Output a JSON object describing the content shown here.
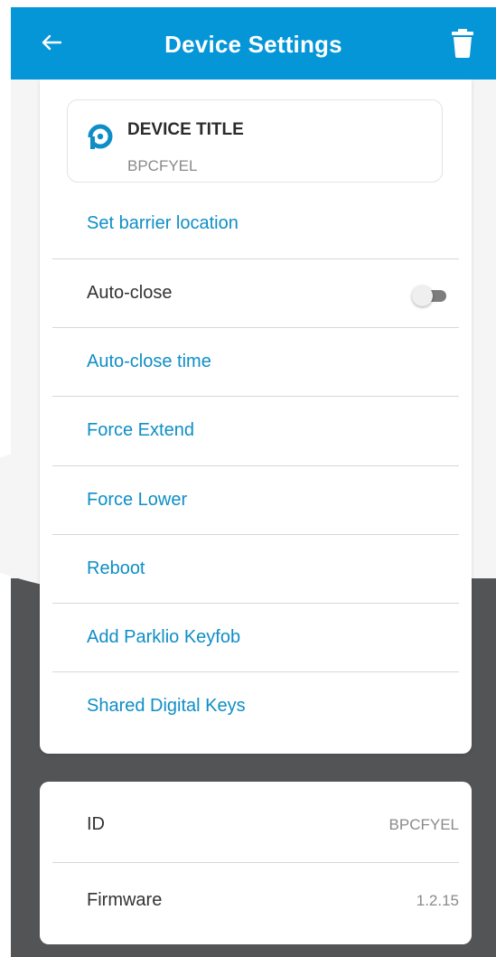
{
  "app_bar": {
    "title": "Device Settings",
    "back_icon": "arrow-left-icon",
    "delete_icon": "trash-icon",
    "color": "#0596d8"
  },
  "device": {
    "heading": "DEVICE TITLE",
    "value": "BPCFYEL",
    "logo_icon": "parklio-logo-icon"
  },
  "menu": {
    "set_barrier_location": "Set barrier location",
    "auto_close": "Auto-close",
    "auto_close_enabled": false,
    "auto_close_time": "Auto-close time",
    "force_extend": "Force Extend",
    "force_lower": "Force Lower",
    "reboot": "Reboot",
    "add_keyfob": "Add Parklio Keyfob",
    "shared_digital_keys": "Shared Digital Keys"
  },
  "info": {
    "id_label": "ID",
    "id_value": "BPCFYEL",
    "firmware_label": "Firmware",
    "firmware_value": "1.2.15"
  },
  "colors": {
    "link": "#0f8ec6",
    "background_dark": "#525456"
  }
}
